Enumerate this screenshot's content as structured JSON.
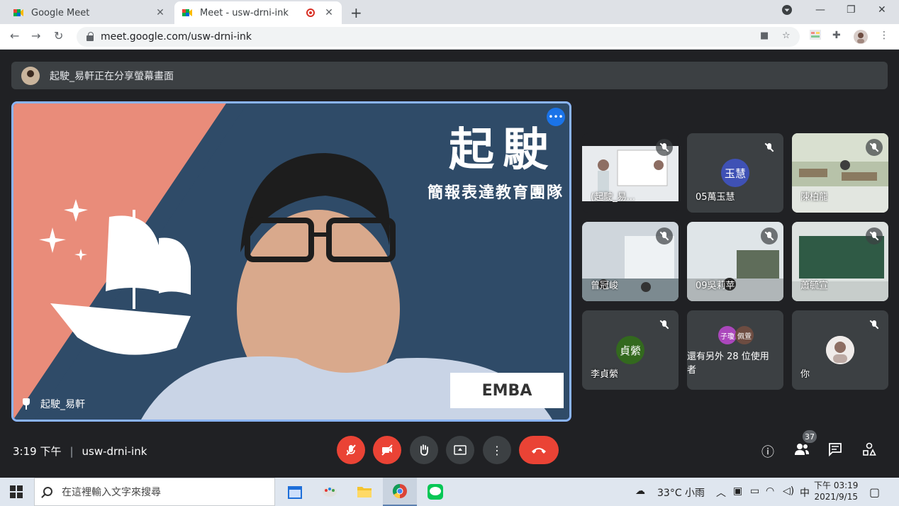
{
  "browser": {
    "tabs": [
      {
        "title": "Google Meet",
        "active": false
      },
      {
        "title": "Meet - usw-drni-ink",
        "active": true
      }
    ],
    "url": "meet.google.com/usw-drni-ink"
  },
  "meet": {
    "presenting_banner": "起駛_易軒正在分享螢幕畫面",
    "main_speaker": {
      "name": "起駛_易軒",
      "slide_title": "起駛",
      "slide_subtitle": "簡報表達教育團隊",
      "slide_logo": "EMBA"
    },
    "tiles": [
      {
        "name": "(起駛_易...",
        "muted": true,
        "kind": "presentation"
      },
      {
        "name": "05萬玉慧",
        "muted": true,
        "kind": "avatar",
        "initials": "玉慧",
        "color": "#3f51b5"
      },
      {
        "name": "陳柏龍",
        "muted": true,
        "kind": "video"
      },
      {
        "name": "曾冠峻",
        "muted": true,
        "kind": "video"
      },
      {
        "name": "09吳莉苹",
        "muted": true,
        "kind": "video"
      },
      {
        "name": "蕭毓宣",
        "muted": true,
        "kind": "video"
      },
      {
        "name": "李貞縈",
        "muted": true,
        "kind": "avatar",
        "initials": "貞縈",
        "color": "#33691e"
      },
      {
        "name": "還有另外 28 位使用者",
        "muted": false,
        "kind": "others",
        "initials": [
          "子瓊",
          "佩萱"
        ]
      },
      {
        "name": "你",
        "muted": true,
        "kind": "self"
      }
    ],
    "time": "3:19 下午",
    "meeting_code": "usw-drni-ink",
    "participant_count": "37"
  },
  "taskbar": {
    "search_placeholder": "在這裡輸入文字來搜尋",
    "weather": "33°C 小雨",
    "ime": "中",
    "clock_time": "下午 03:19",
    "clock_date": "2021/9/15"
  },
  "colors": {
    "accent": "#8ab4f8",
    "hangup": "#ea4335",
    "slide_salmon": "#e98c7a",
    "slide_navy": "#2f4b68"
  }
}
